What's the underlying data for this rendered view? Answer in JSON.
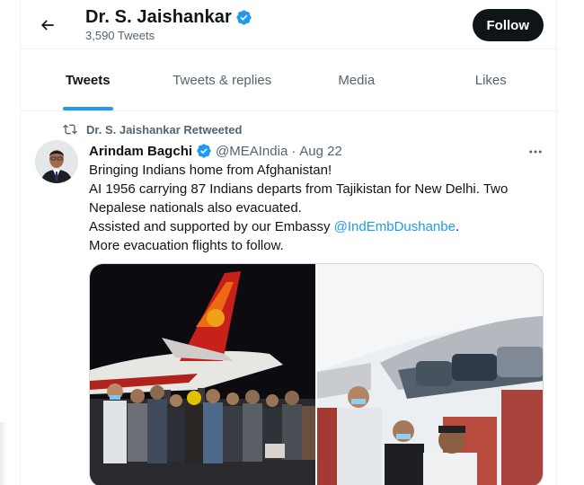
{
  "header": {
    "back_icon": "arrow-left-icon",
    "name": "Dr. S. Jaishankar",
    "verified_icon": "verified-badge-icon",
    "tweet_count": "3,590 Tweets",
    "follow_label": "Follow"
  },
  "tabs": [
    {
      "label": "Tweets",
      "active": true
    },
    {
      "label": "Tweets & replies",
      "active": false
    },
    {
      "label": "Media",
      "active": false
    },
    {
      "label": "Likes",
      "active": false
    }
  ],
  "tweet": {
    "retweet_icon": "retweet-icon",
    "retweeted_by": "Dr. S. Jaishankar Retweeted",
    "author_name": "Arindam Bagchi",
    "author_handle": "@MEAIndia",
    "separator": "·",
    "date": "Aug 22",
    "more_icon": "more-dots-icon",
    "lines": {
      "line1": "Bringing Indians home from Afghanistan!",
      "line2": "AI 1956 carrying 87 Indians departs from Tajikistan for New Delhi. Two Nepalese nationals also evacuated.",
      "line3_prefix": "Assisted and supported by our Embassy ",
      "line3_mention": "@IndEmbDushanbe",
      "line3_suffix": ".",
      "line4": "More evacuation flights to follow."
    },
    "media": [
      {
        "name": "evacuees-near-aircraft-photo"
      },
      {
        "name": "evacuees-inside-cabin-photo"
      }
    ]
  },
  "colors": {
    "accent": "#1d9bf0",
    "text_primary": "#0f1419",
    "text_secondary": "#536471",
    "follow_bg": "#0f1419",
    "border": "#eff3f4"
  }
}
